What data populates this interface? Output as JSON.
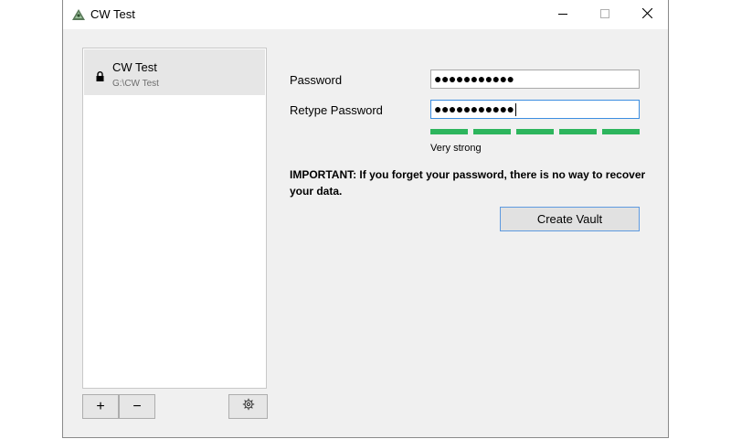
{
  "window": {
    "title": "CW Test",
    "controls": {
      "minimize_icon": "minimize-icon",
      "maximize_icon": "maximize-icon",
      "close_icon": "close-icon"
    }
  },
  "sidebar": {
    "vaults": [
      {
        "name": "CW Test",
        "path": "G:\\CW Test",
        "icon": "lock-icon"
      }
    ],
    "add_label": "+",
    "remove_label": "−",
    "settings_icon": "gear-icon"
  },
  "form": {
    "password_label": "Password",
    "password_value": "●●●●●●●●●●●",
    "retype_label": "Retype Password",
    "retype_value": "●●●●●●●●●●●",
    "strength": {
      "segments_filled": 5,
      "segments_total": 5,
      "label": "Very strong",
      "color": "#2db55d"
    },
    "important_text": "IMPORTANT: If you forget your password, there is no way to recover your data.",
    "create_button": "Create Vault"
  },
  "colors": {
    "accent": "#5e9ae0",
    "focus": "#3d8ee0"
  }
}
